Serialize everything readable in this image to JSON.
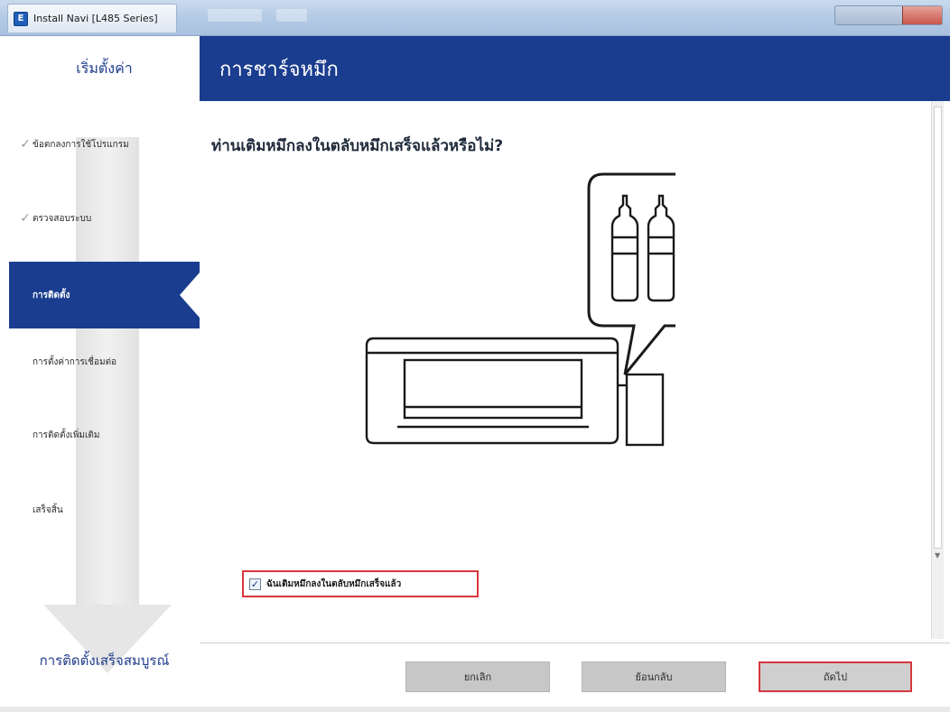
{
  "window": {
    "title": "Install Navi [L485 Series]",
    "icon": "epson-app-icon"
  },
  "sidebar": {
    "header": "เริ่มตั้งค่า",
    "steps": [
      {
        "label": "ข้อตกลงการใช้โปรแกรม",
        "state": "done"
      },
      {
        "label": "ตรวจสอบระบบ",
        "state": "done"
      },
      {
        "label": "การติดตั้ง",
        "state": "active"
      },
      {
        "label": "การตั้งค่าการเชื่อมต่อ",
        "state": "pending"
      },
      {
        "label": "การติดตั้งเพิ่มเติม",
        "state": "pending"
      },
      {
        "label": "เสร็จสิ้น",
        "state": "pending"
      }
    ],
    "footer": "การติดตั้งเสร็จสมบูรณ์"
  },
  "main": {
    "title": "การชาร์จหมึก",
    "question": "ท่านเติมหมึกลงในตลับหมึกเสร็จแล้วหรือไม่?",
    "confirm_checkbox": {
      "label": "ฉันเติมหมึกลงในตลับหมึกเสร็จแล้ว",
      "checked": true
    }
  },
  "buttons": {
    "cancel": "ยกเลิก",
    "back": "ย้อนกลับ",
    "next": "ถัดไป"
  },
  "colors": {
    "brand_blue": "#1a3d8f",
    "highlight_red": "#d9363e"
  }
}
